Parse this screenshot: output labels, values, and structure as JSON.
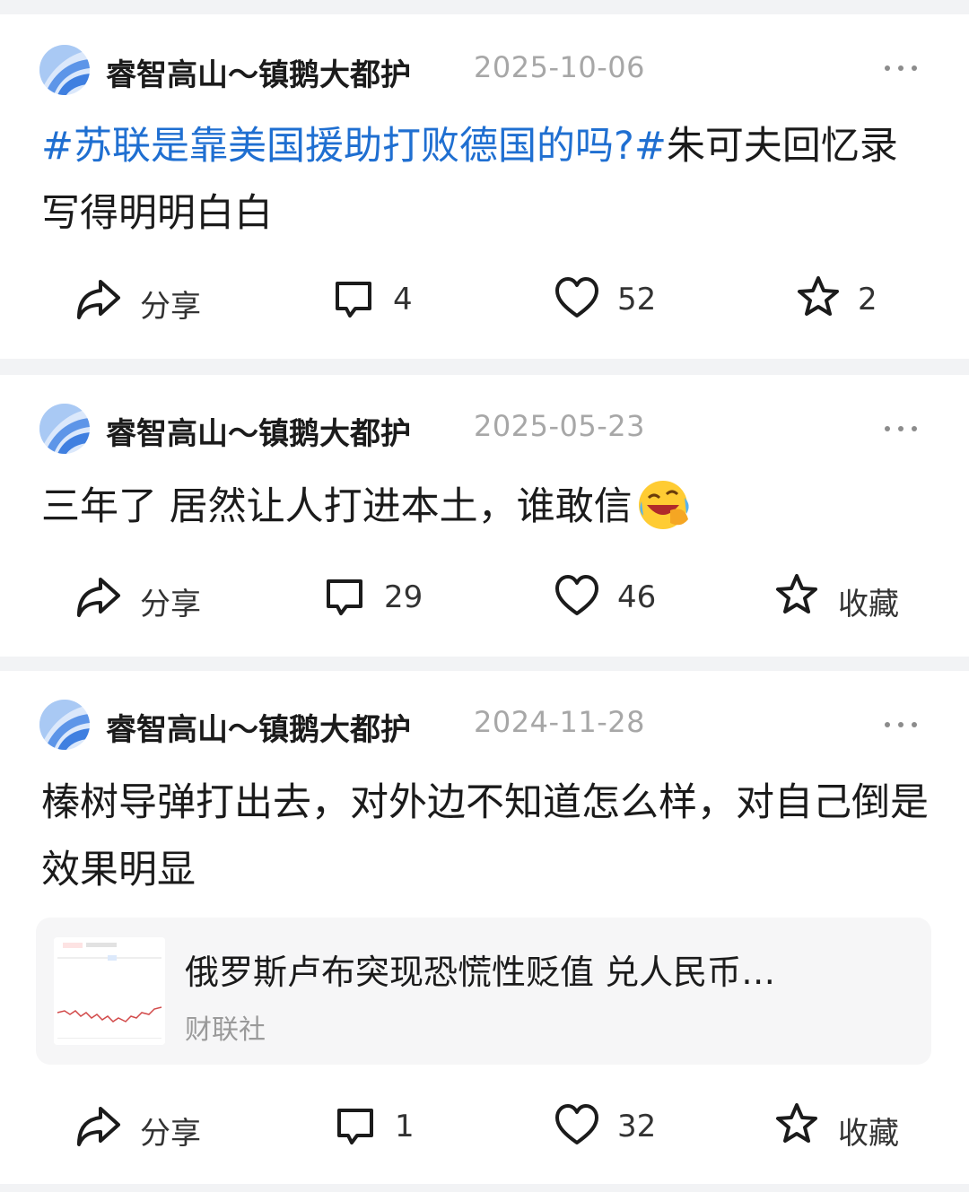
{
  "posts": [
    {
      "user": "睿智高山～镇鹅大都护",
      "date": "2025-10-06",
      "text_tag": "#苏联是靠美国援助打败德国的吗?#",
      "text": "朱可夫回忆录写得明明白白",
      "actions": {
        "share": "分享",
        "comments": "4",
        "likes": "52",
        "favorite": "2"
      }
    },
    {
      "user": "睿智高山～镇鹅大都护",
      "date": "2025-05-23",
      "text": "三年了 居然让人打进本土，谁敢信",
      "emoji": "rolling-on-floor-laughing",
      "actions": {
        "share": "分享",
        "comments": "29",
        "likes": "46",
        "favorite": "收藏"
      }
    },
    {
      "user": "睿智高山～镇鹅大都护",
      "date": "2024-11-28",
      "text": "榛树导弹打出去，对外边不知道怎么样，对自己倒是效果明显",
      "link": {
        "title": "俄罗斯卢布突现恐慌性贬值 兑人民币…",
        "source": "财联社"
      },
      "actions": {
        "share": "分享",
        "comments": "1",
        "likes": "32",
        "favorite": "收藏"
      }
    }
  ],
  "colors": {
    "tag": "#1f6fd1",
    "avatar": "#6fa3ee",
    "date": "#a7a7a7"
  }
}
